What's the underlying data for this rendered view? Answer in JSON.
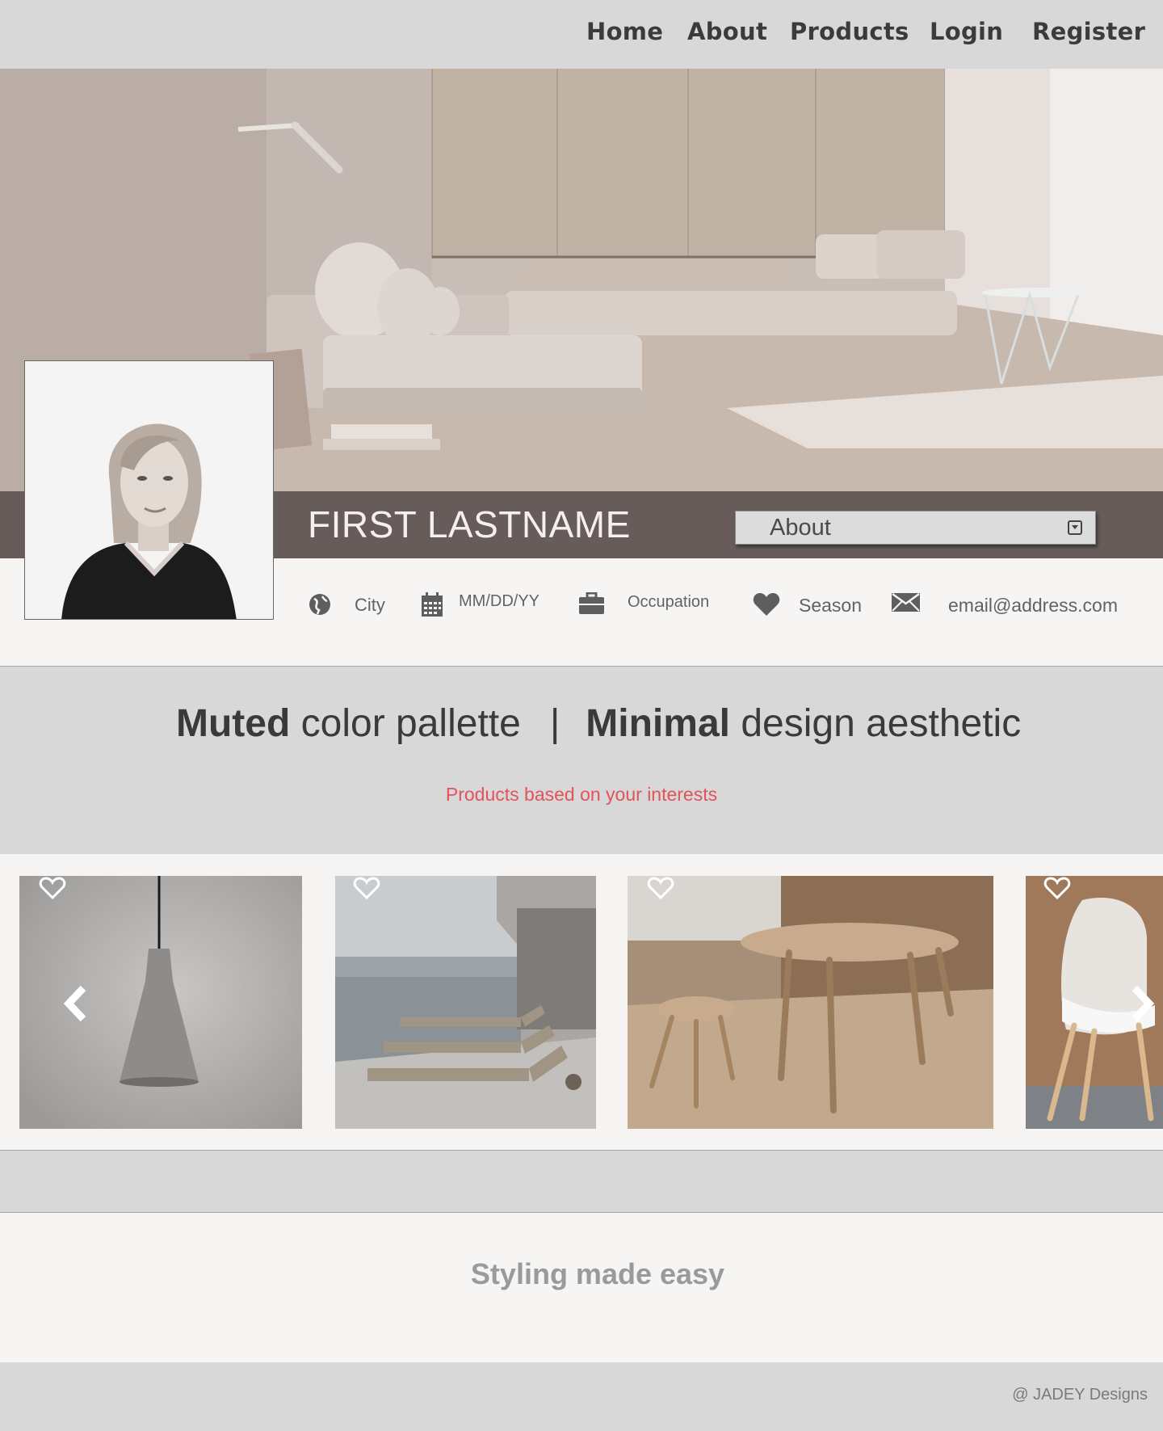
{
  "nav": {
    "items": [
      {
        "label": "Home"
      },
      {
        "label": "About"
      },
      {
        "label": "Products"
      },
      {
        "label": "Login"
      },
      {
        "label": "Register"
      }
    ]
  },
  "profile": {
    "name": "FIRST LASTNAME",
    "dropdown_selected": "About",
    "info": {
      "city": "City",
      "date": "MM/DD/YY",
      "occupation": "Occupation",
      "season": "Season",
      "email": "email@address.com"
    }
  },
  "tagline": {
    "part1_bold": "Muted",
    "part1_rest": "color pallette",
    "separator": "|",
    "part2_bold": "Minimal",
    "part2_rest": "design aesthetic",
    "subtitle": "Products based on your interests"
  },
  "products": [
    {
      "name": "pendant-lamp"
    },
    {
      "name": "sun-loungers"
    },
    {
      "name": "dining-table"
    },
    {
      "name": "chair"
    }
  ],
  "slogan": "Styling made easy",
  "footer": {
    "credit": "@ JADEY Designs"
  },
  "colors": {
    "nav_bg": "#d8d8d8",
    "profile_bar": "#675c5a",
    "accent_red": "#e2535a",
    "page_bg": "#f6f5f4"
  },
  "icons": [
    "globe-icon",
    "calendar-icon",
    "briefcase-icon",
    "heart-icon",
    "envelope-icon",
    "chevron-left-icon",
    "chevron-right-icon",
    "dropdown-caret-icon"
  ]
}
